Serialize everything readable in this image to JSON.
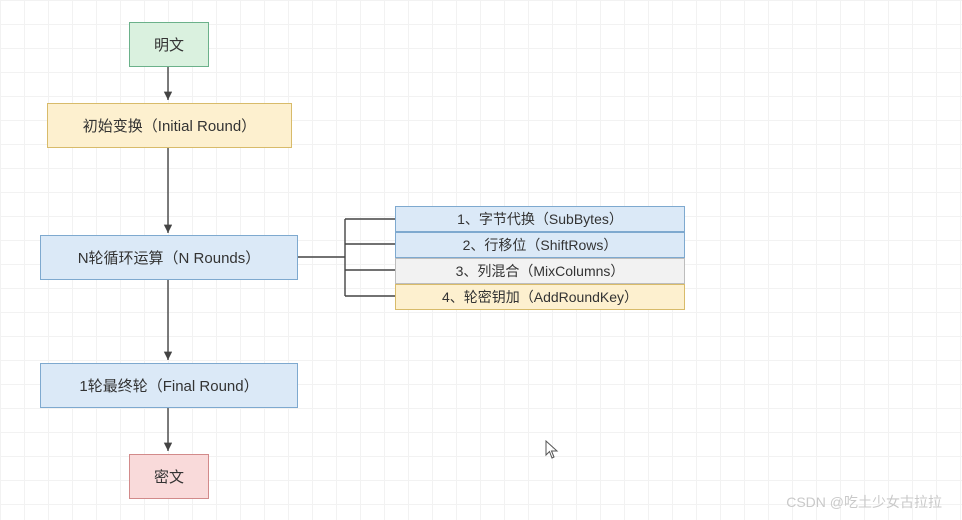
{
  "nodes": {
    "plaintext": "明文",
    "initial": "初始变换（Initial Round）",
    "rounds": "N轮循环运算（N Rounds）",
    "final": "1轮最终轮（Final Round）",
    "ciphertext": "密文"
  },
  "round_steps": {
    "s1": "1、字节代换（SubBytes）",
    "s2": "2、行移位（ShiftRows）",
    "s3": "3、列混合（MixColumns）",
    "s4": "4、轮密钥加（AddRoundKey）"
  },
  "watermark": "CSDN @吃土少女古拉拉"
}
